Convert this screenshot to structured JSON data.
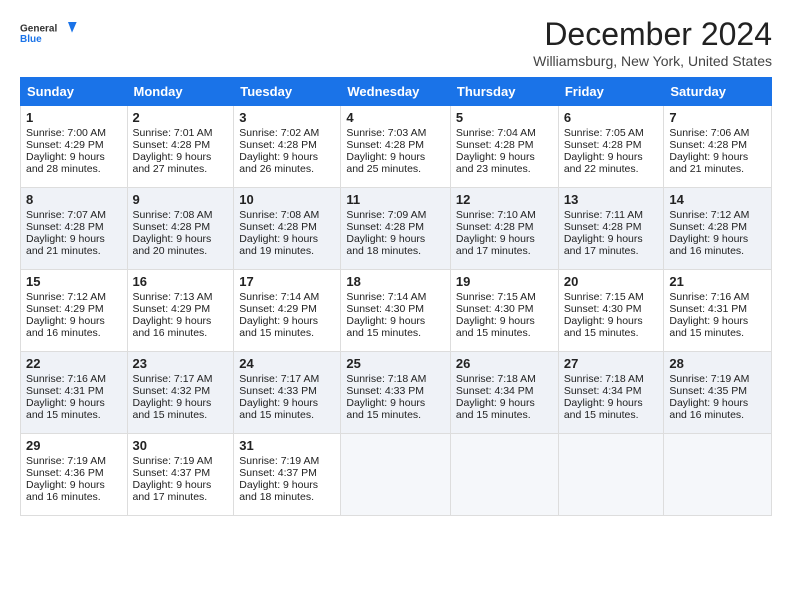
{
  "header": {
    "logo_general": "General",
    "logo_blue": "Blue",
    "month_title": "December 2024",
    "location": "Williamsburg, New York, United States"
  },
  "weekdays": [
    "Sunday",
    "Monday",
    "Tuesday",
    "Wednesday",
    "Thursday",
    "Friday",
    "Saturday"
  ],
  "weeks": [
    [
      {
        "day": "1",
        "sunrise": "Sunrise: 7:00 AM",
        "sunset": "Sunset: 4:29 PM",
        "daylight": "Daylight: 9 hours and 28 minutes."
      },
      {
        "day": "2",
        "sunrise": "Sunrise: 7:01 AM",
        "sunset": "Sunset: 4:28 PM",
        "daylight": "Daylight: 9 hours and 27 minutes."
      },
      {
        "day": "3",
        "sunrise": "Sunrise: 7:02 AM",
        "sunset": "Sunset: 4:28 PM",
        "daylight": "Daylight: 9 hours and 26 minutes."
      },
      {
        "day": "4",
        "sunrise": "Sunrise: 7:03 AM",
        "sunset": "Sunset: 4:28 PM",
        "daylight": "Daylight: 9 hours and 25 minutes."
      },
      {
        "day": "5",
        "sunrise": "Sunrise: 7:04 AM",
        "sunset": "Sunset: 4:28 PM",
        "daylight": "Daylight: 9 hours and 23 minutes."
      },
      {
        "day": "6",
        "sunrise": "Sunrise: 7:05 AM",
        "sunset": "Sunset: 4:28 PM",
        "daylight": "Daylight: 9 hours and 22 minutes."
      },
      {
        "day": "7",
        "sunrise": "Sunrise: 7:06 AM",
        "sunset": "Sunset: 4:28 PM",
        "daylight": "Daylight: 9 hours and 21 minutes."
      }
    ],
    [
      {
        "day": "8",
        "sunrise": "Sunrise: 7:07 AM",
        "sunset": "Sunset: 4:28 PM",
        "daylight": "Daylight: 9 hours and 21 minutes."
      },
      {
        "day": "9",
        "sunrise": "Sunrise: 7:08 AM",
        "sunset": "Sunset: 4:28 PM",
        "daylight": "Daylight: 9 hours and 20 minutes."
      },
      {
        "day": "10",
        "sunrise": "Sunrise: 7:08 AM",
        "sunset": "Sunset: 4:28 PM",
        "daylight": "Daylight: 9 hours and 19 minutes."
      },
      {
        "day": "11",
        "sunrise": "Sunrise: 7:09 AM",
        "sunset": "Sunset: 4:28 PM",
        "daylight": "Daylight: 9 hours and 18 minutes."
      },
      {
        "day": "12",
        "sunrise": "Sunrise: 7:10 AM",
        "sunset": "Sunset: 4:28 PM",
        "daylight": "Daylight: 9 hours and 17 minutes."
      },
      {
        "day": "13",
        "sunrise": "Sunrise: 7:11 AM",
        "sunset": "Sunset: 4:28 PM",
        "daylight": "Daylight: 9 hours and 17 minutes."
      },
      {
        "day": "14",
        "sunrise": "Sunrise: 7:12 AM",
        "sunset": "Sunset: 4:28 PM",
        "daylight": "Daylight: 9 hours and 16 minutes."
      }
    ],
    [
      {
        "day": "15",
        "sunrise": "Sunrise: 7:12 AM",
        "sunset": "Sunset: 4:29 PM",
        "daylight": "Daylight: 9 hours and 16 minutes."
      },
      {
        "day": "16",
        "sunrise": "Sunrise: 7:13 AM",
        "sunset": "Sunset: 4:29 PM",
        "daylight": "Daylight: 9 hours and 16 minutes."
      },
      {
        "day": "17",
        "sunrise": "Sunrise: 7:14 AM",
        "sunset": "Sunset: 4:29 PM",
        "daylight": "Daylight: 9 hours and 15 minutes."
      },
      {
        "day": "18",
        "sunrise": "Sunrise: 7:14 AM",
        "sunset": "Sunset: 4:30 PM",
        "daylight": "Daylight: 9 hours and 15 minutes."
      },
      {
        "day": "19",
        "sunrise": "Sunrise: 7:15 AM",
        "sunset": "Sunset: 4:30 PM",
        "daylight": "Daylight: 9 hours and 15 minutes."
      },
      {
        "day": "20",
        "sunrise": "Sunrise: 7:15 AM",
        "sunset": "Sunset: 4:30 PM",
        "daylight": "Daylight: 9 hours and 15 minutes."
      },
      {
        "day": "21",
        "sunrise": "Sunrise: 7:16 AM",
        "sunset": "Sunset: 4:31 PM",
        "daylight": "Daylight: 9 hours and 15 minutes."
      }
    ],
    [
      {
        "day": "22",
        "sunrise": "Sunrise: 7:16 AM",
        "sunset": "Sunset: 4:31 PM",
        "daylight": "Daylight: 9 hours and 15 minutes."
      },
      {
        "day": "23",
        "sunrise": "Sunrise: 7:17 AM",
        "sunset": "Sunset: 4:32 PM",
        "daylight": "Daylight: 9 hours and 15 minutes."
      },
      {
        "day": "24",
        "sunrise": "Sunrise: 7:17 AM",
        "sunset": "Sunset: 4:33 PM",
        "daylight": "Daylight: 9 hours and 15 minutes."
      },
      {
        "day": "25",
        "sunrise": "Sunrise: 7:18 AM",
        "sunset": "Sunset: 4:33 PM",
        "daylight": "Daylight: 9 hours and 15 minutes."
      },
      {
        "day": "26",
        "sunrise": "Sunrise: 7:18 AM",
        "sunset": "Sunset: 4:34 PM",
        "daylight": "Daylight: 9 hours and 15 minutes."
      },
      {
        "day": "27",
        "sunrise": "Sunrise: 7:18 AM",
        "sunset": "Sunset: 4:34 PM",
        "daylight": "Daylight: 9 hours and 15 minutes."
      },
      {
        "day": "28",
        "sunrise": "Sunrise: 7:19 AM",
        "sunset": "Sunset: 4:35 PM",
        "daylight": "Daylight: 9 hours and 16 minutes."
      }
    ],
    [
      {
        "day": "29",
        "sunrise": "Sunrise: 7:19 AM",
        "sunset": "Sunset: 4:36 PM",
        "daylight": "Daylight: 9 hours and 16 minutes."
      },
      {
        "day": "30",
        "sunrise": "Sunrise: 7:19 AM",
        "sunset": "Sunset: 4:37 PM",
        "daylight": "Daylight: 9 hours and 17 minutes."
      },
      {
        "day": "31",
        "sunrise": "Sunrise: 7:19 AM",
        "sunset": "Sunset: 4:37 PM",
        "daylight": "Daylight: 9 hours and 18 minutes."
      },
      null,
      null,
      null,
      null
    ]
  ]
}
